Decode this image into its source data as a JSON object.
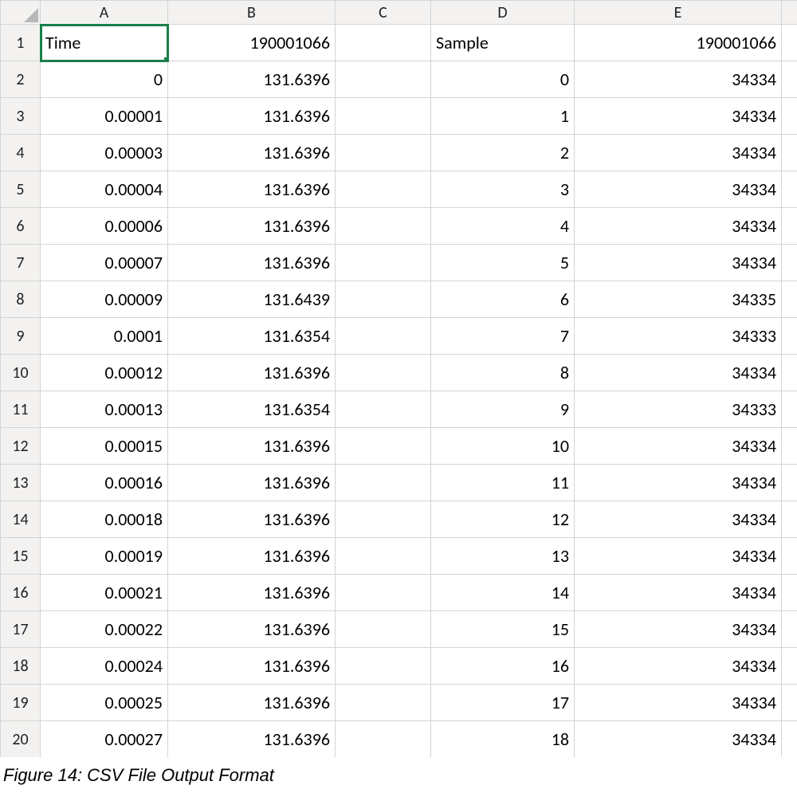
{
  "caption": "Figure 14: CSV File Output Format",
  "columns": [
    "A",
    "B",
    "C",
    "D",
    "E"
  ],
  "selected_cell": "A1",
  "rows": [
    {
      "n": "1",
      "A": "Time",
      "B": "190001066",
      "C": "",
      "D": "Sample",
      "E": "190001066"
    },
    {
      "n": "2",
      "A": "0",
      "B": "131.6396",
      "C": "",
      "D": "0",
      "E": "34334"
    },
    {
      "n": "3",
      "A": "0.00001",
      "B": "131.6396",
      "C": "",
      "D": "1",
      "E": "34334"
    },
    {
      "n": "4",
      "A": "0.00003",
      "B": "131.6396",
      "C": "",
      "D": "2",
      "E": "34334"
    },
    {
      "n": "5",
      "A": "0.00004",
      "B": "131.6396",
      "C": "",
      "D": "3",
      "E": "34334"
    },
    {
      "n": "6",
      "A": "0.00006",
      "B": "131.6396",
      "C": "",
      "D": "4",
      "E": "34334"
    },
    {
      "n": "7",
      "A": "0.00007",
      "B": "131.6396",
      "C": "",
      "D": "5",
      "E": "34334"
    },
    {
      "n": "8",
      "A": "0.00009",
      "B": "131.6439",
      "C": "",
      "D": "6",
      "E": "34335"
    },
    {
      "n": "9",
      "A": "0.0001",
      "B": "131.6354",
      "C": "",
      "D": "7",
      "E": "34333"
    },
    {
      "n": "10",
      "A": "0.00012",
      "B": "131.6396",
      "C": "",
      "D": "8",
      "E": "34334"
    },
    {
      "n": "11",
      "A": "0.00013",
      "B": "131.6354",
      "C": "",
      "D": "9",
      "E": "34333"
    },
    {
      "n": "12",
      "A": "0.00015",
      "B": "131.6396",
      "C": "",
      "D": "10",
      "E": "34334"
    },
    {
      "n": "13",
      "A": "0.00016",
      "B": "131.6396",
      "C": "",
      "D": "11",
      "E": "34334"
    },
    {
      "n": "14",
      "A": "0.00018",
      "B": "131.6396",
      "C": "",
      "D": "12",
      "E": "34334"
    },
    {
      "n": "15",
      "A": "0.00019",
      "B": "131.6396",
      "C": "",
      "D": "13",
      "E": "34334"
    },
    {
      "n": "16",
      "A": "0.00021",
      "B": "131.6396",
      "C": "",
      "D": "14",
      "E": "34334"
    },
    {
      "n": "17",
      "A": "0.00022",
      "B": "131.6396",
      "C": "",
      "D": "15",
      "E": "34334"
    },
    {
      "n": "18",
      "A": "0.00024",
      "B": "131.6396",
      "C": "",
      "D": "16",
      "E": "34334"
    },
    {
      "n": "19",
      "A": "0.00025",
      "B": "131.6396",
      "C": "",
      "D": "17",
      "E": "34334"
    },
    {
      "n": "20",
      "A": "0.00027",
      "B": "131.6396",
      "C": "",
      "D": "18",
      "E": "34334"
    }
  ]
}
